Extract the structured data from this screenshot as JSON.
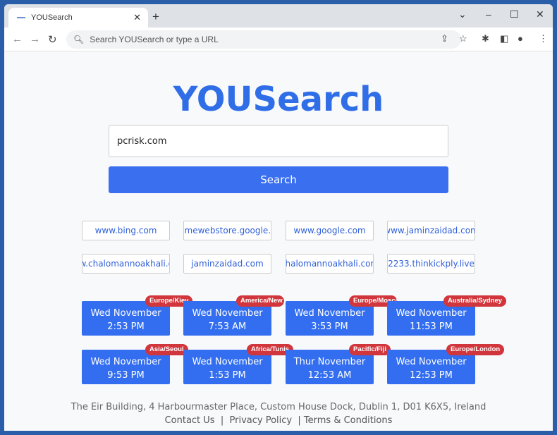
{
  "browser": {
    "tab_title": "YOUSearch",
    "omnibox_placeholder": "Search YOUSearch or type a URL"
  },
  "page": {
    "logo": "YOUSearch",
    "search_value": "pcrisk.com",
    "search_button": "Search",
    "links": [
      "www.bing.com",
      "chromewebstore.google.com",
      "www.google.com",
      "www.jaminzaidad.com",
      "www.chalomannoakhali.com",
      "jaminzaidad.com",
      "chalomannoakhali.com",
      "2233.thinkickply.live"
    ],
    "clocks": [
      {
        "zone": "Europe/Kiev",
        "day": "Wed November",
        "time": "2:53 PM"
      },
      {
        "zone": "America/New_York",
        "day": "Wed November",
        "time": "7:53 AM"
      },
      {
        "zone": "Europe/Moscow",
        "day": "Wed November",
        "time": "3:53 PM"
      },
      {
        "zone": "Australia/Sydney",
        "day": "Wed November",
        "time": "11:53 PM"
      },
      {
        "zone": "Asia/Seoul",
        "day": "Wed November",
        "time": "9:53 PM"
      },
      {
        "zone": "Africa/Tunis",
        "day": "Wed November",
        "time": "1:53 PM"
      },
      {
        "zone": "Pacific/Fiji",
        "day": "Thur November",
        "time": "12:53 AM"
      },
      {
        "zone": "Europe/London",
        "day": "Wed November",
        "time": "12:53 PM"
      }
    ],
    "footer": {
      "address": "The Eir Building, 4 Harbourmaster Place, Custom House Dock, Dublin 1, D01 K6X5, Ireland",
      "contact": "Contact Us",
      "privacy": "Privacy Policy",
      "terms": "Terms & Conditions",
      "sep": "|"
    }
  },
  "colors": {
    "accent": "#336ef0",
    "badge": "#d0363c"
  }
}
